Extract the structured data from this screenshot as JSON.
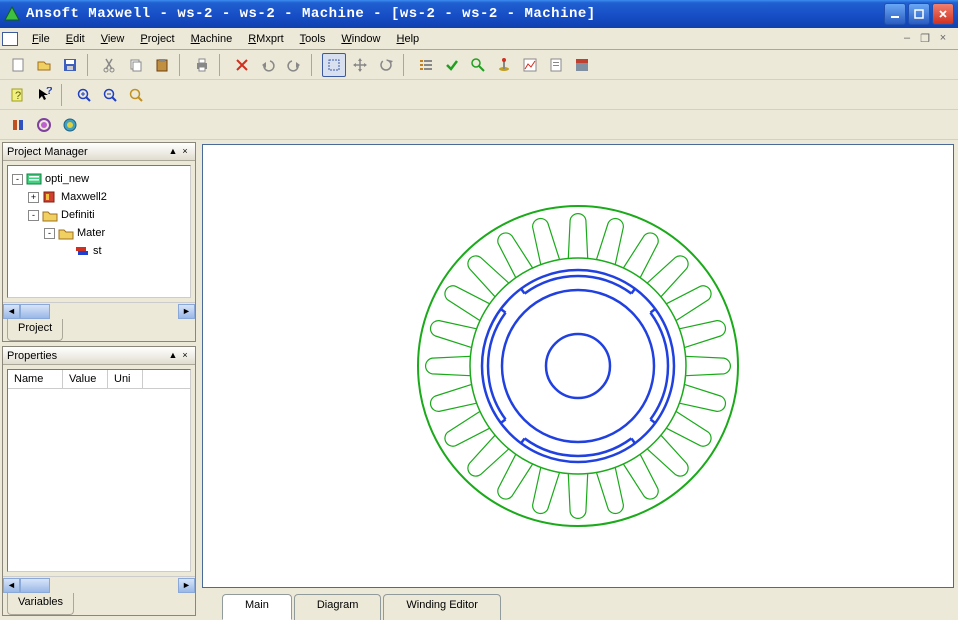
{
  "titlebar": {
    "title": "Ansoft Maxwell - ws-2 - ws-2 - Machine - [ws-2 - ws-2 - Machine]"
  },
  "menubar": {
    "items": [
      {
        "label": "File",
        "u": "F"
      },
      {
        "label": "Edit",
        "u": "E"
      },
      {
        "label": "View",
        "u": "V"
      },
      {
        "label": "Project",
        "u": "P"
      },
      {
        "label": "Machine",
        "u": "M"
      },
      {
        "label": "RMxprt",
        "u": "R"
      },
      {
        "label": "Tools",
        "u": "T"
      },
      {
        "label": "Window",
        "u": "W"
      },
      {
        "label": "Help",
        "u": "H"
      }
    ]
  },
  "panels": {
    "project": {
      "title": "Project Manager",
      "tab": "Project",
      "tree": [
        {
          "indent": 0,
          "exp": "-",
          "icon": "project",
          "label": "opti_new"
        },
        {
          "indent": 1,
          "exp": "+",
          "icon": "design",
          "label": "Maxwell2"
        },
        {
          "indent": 1,
          "exp": "-",
          "icon": "folder",
          "label": "Definiti"
        },
        {
          "indent": 2,
          "exp": "-",
          "icon": "folder",
          "label": "Mater"
        },
        {
          "indent": 3,
          "exp": "",
          "icon": "mat",
          "label": "st"
        }
      ]
    },
    "properties": {
      "title": "Properties",
      "cols": [
        "Name",
        "Value",
        "Uni"
      ],
      "tab": "Variables"
    }
  },
  "bottomTabs": {
    "items": [
      "Main",
      "Diagram",
      "Winding Editor"
    ],
    "active": 0
  },
  "chart_data": {
    "type": "diagram",
    "description": "Electrical machine cross-section (RMxprt). Outer green stator circle, ring of 24 green stator slots, inner blue rotor with 4 pole arc segments and central shaft circle.",
    "outer_stator_radius": 160,
    "stator_inner_radius": 108,
    "slot_count": 24,
    "slot_depth": 38,
    "rotor_outer_radius": 96,
    "pole_arc_count": 4,
    "rotor_core_radius": 76,
    "shaft_radius": 32,
    "colors": {
      "stator": "#1aaa1a",
      "rotor": "#2040e0"
    }
  }
}
